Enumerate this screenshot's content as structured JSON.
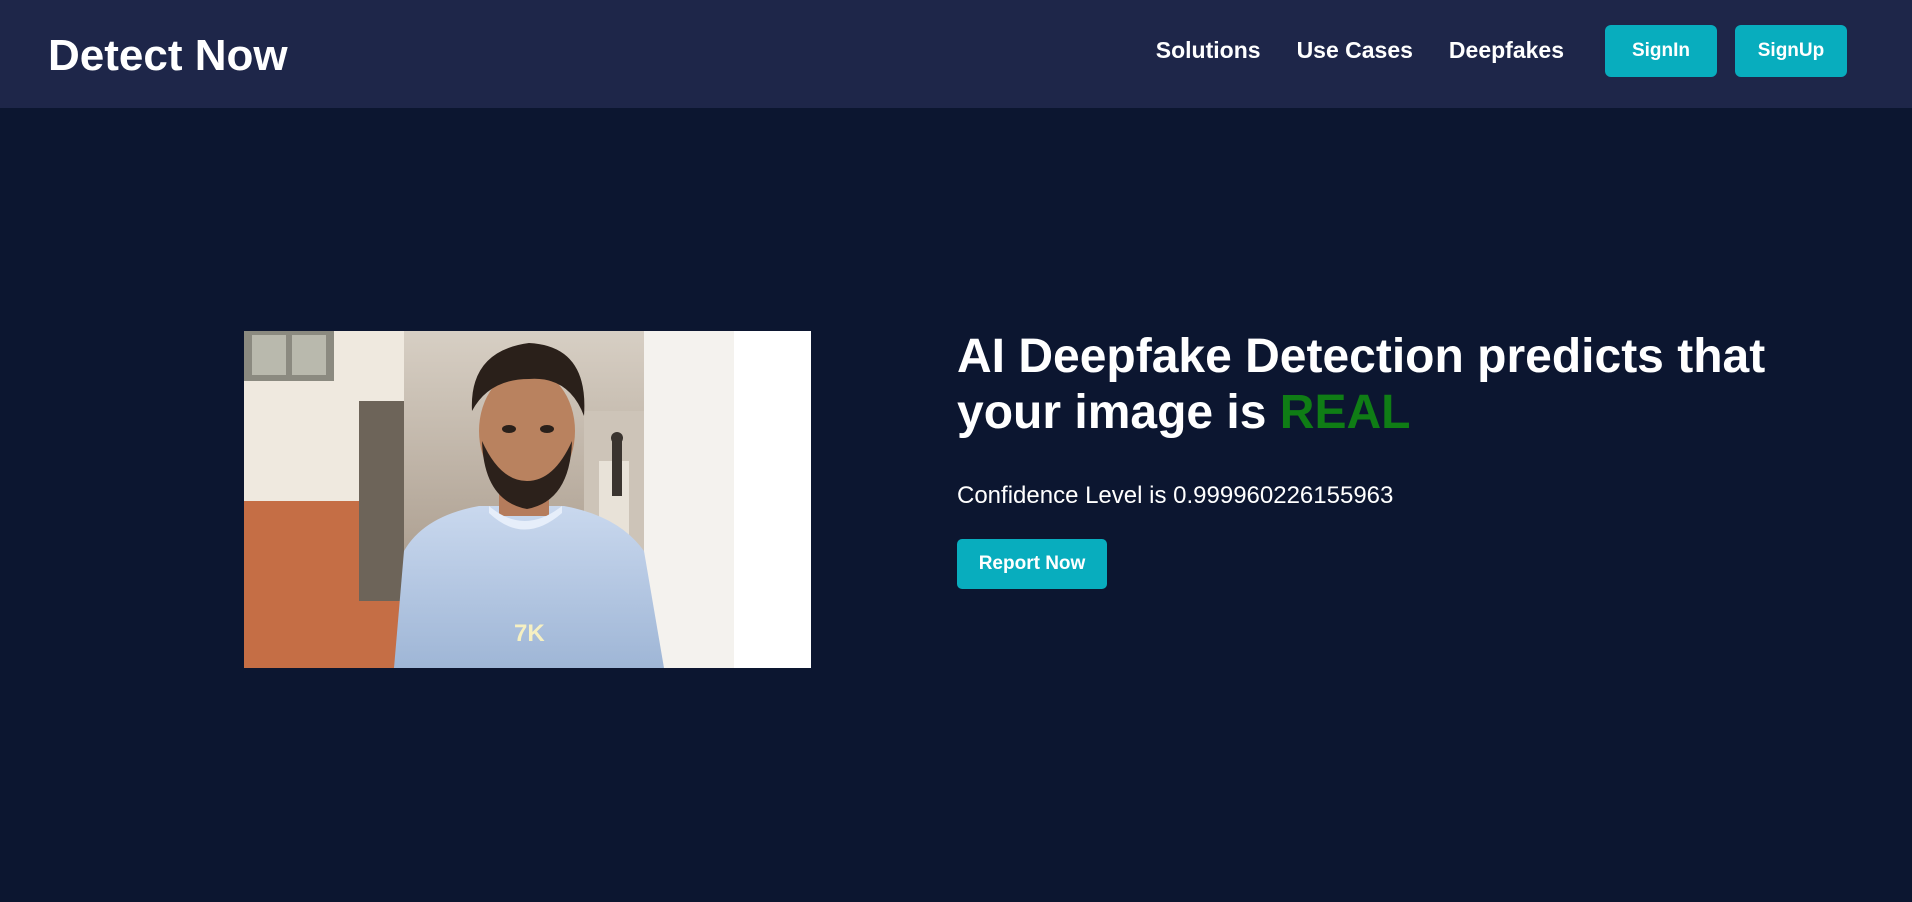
{
  "header": {
    "brand": "Detect Now",
    "nav": [
      {
        "label": "Solutions"
      },
      {
        "label": "Use Cases"
      },
      {
        "label": "Deepfakes"
      }
    ],
    "signin_label": "SignIn",
    "signup_label": "SignUp"
  },
  "result": {
    "headline_prefix": "AI Deepfake Detection predicts that your image is ",
    "verdict": "REAL",
    "confidence_text": "Confidence Level is 0.999960226155963",
    "confidence_value": 0.999960226155963,
    "report_label": "Report Now"
  },
  "photo": {
    "shirt_logo": "7K"
  },
  "colors": {
    "page_bg": "#0c1630",
    "navbar_bg": "#1e2649",
    "accent": "#08adbe",
    "verdict_real": "#0f7d15"
  }
}
